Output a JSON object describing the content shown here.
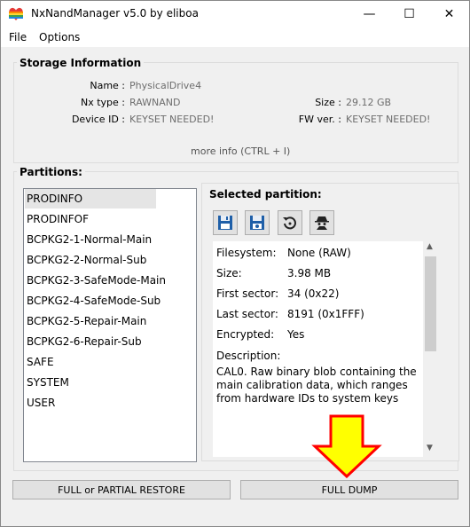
{
  "window": {
    "title": "NxNandManager v5.0 by eliboa",
    "minimize": "—",
    "maximize": "☐",
    "close": "✕"
  },
  "menu": {
    "file": "File",
    "options": "Options"
  },
  "storage": {
    "heading": "Storage Information",
    "name_label": "Name :",
    "name_value": "PhysicalDrive4",
    "nxtype_label": "Nx type :",
    "nxtype_value": "RAWNAND",
    "size_label": "Size :",
    "size_value": "29.12 GB",
    "deviceid_label": "Device ID :",
    "deviceid_value": "KEYSET NEEDED!",
    "fwver_label": "FW ver. :",
    "fwver_value": "KEYSET NEEDED!",
    "more_info": "more info (CTRL + I)"
  },
  "partitions": {
    "heading": "Partitions:",
    "items": [
      {
        "label": "PRODINFO",
        "selected": true
      },
      {
        "label": "PRODINFOF"
      },
      {
        "label": "BCPKG2-1-Normal-Main"
      },
      {
        "label": "BCPKG2-2-Normal-Sub"
      },
      {
        "label": "BCPKG2-3-SafeMode-Main"
      },
      {
        "label": "BCPKG2-4-SafeMode-Sub"
      },
      {
        "label": "BCPKG2-5-Repair-Main"
      },
      {
        "label": "BCPKG2-6-Repair-Sub"
      },
      {
        "label": "SAFE"
      },
      {
        "label": "SYSTEM"
      },
      {
        "label": "USER"
      }
    ]
  },
  "selected": {
    "heading": "Selected partition:",
    "toolbar_icons": [
      "save-icon",
      "save-settings-icon",
      "restore-icon",
      "spy-icon"
    ],
    "filesystem_label": "Filesystem:",
    "filesystem_value": "None (RAW)",
    "size_label": "Size:",
    "size_value": "3.98 MB",
    "first_label": "First sector:",
    "first_value": "34 (0x22)",
    "last_label": "Last sector:",
    "last_value": "8191 (0x1FFF)",
    "enc_label": "Encrypted:",
    "enc_value": "Yes",
    "desc_label": "Description:",
    "desc_value": "CAL0. Raw binary blob containing the main calibration data, which ranges from hardware IDs to system keys"
  },
  "buttons": {
    "restore": "FULL or PARTIAL RESTORE",
    "dump": "FULL DUMP"
  },
  "colors": {
    "arrow_fill": "#ffff00",
    "arrow_stroke": "#ff0000"
  }
}
